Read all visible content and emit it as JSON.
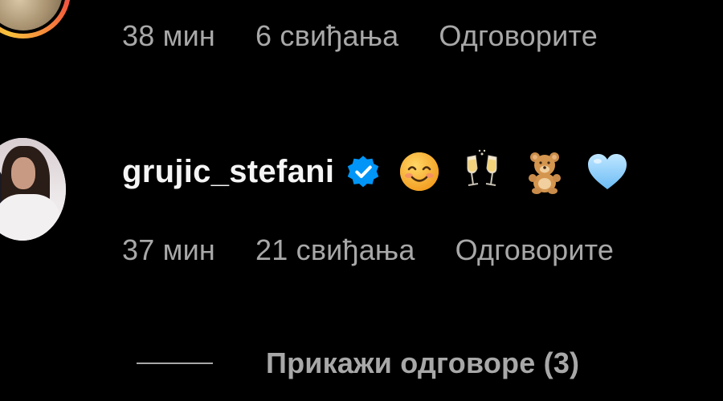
{
  "comment_top": {
    "time": "38 мин",
    "likes": "6 свиђања",
    "reply": "Одговорите"
  },
  "comment_main": {
    "username": "grujic_stefani",
    "verified": true,
    "emojis": [
      "smiling-face-icon",
      "clinking-glasses-icon",
      "teddy-bear-icon",
      "light-blue-heart-icon"
    ],
    "time": "37 мин",
    "likes": "21 свиђања",
    "reply": "Одговорите"
  },
  "replies": {
    "label": "Прикажи одговоре (3)"
  },
  "colors": {
    "background": "#000000",
    "primary_text": "#f5f5f5",
    "secondary_text": "#a8a8a8",
    "verified_blue": "#0095f6"
  }
}
